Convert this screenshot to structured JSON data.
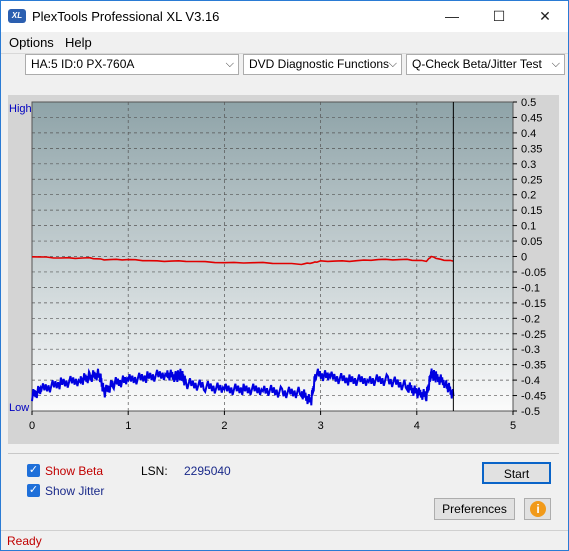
{
  "window": {
    "title": "PlexTools Professional XL V3.16",
    "app_icon": "XL"
  },
  "window_controls": {
    "minimize": "—",
    "maximize": "☐",
    "close": "✕"
  },
  "menu": {
    "options": "Options",
    "help": "Help"
  },
  "toolbar": {
    "drive": "HA:5 ID:0  PX-760A",
    "function": "DVD Diagnostic Functions",
    "test": "Q-Check Beta/Jitter Test"
  },
  "chart_data": {
    "type": "line",
    "x_ticks": [
      "0",
      "1",
      "2",
      "3",
      "4",
      "5"
    ],
    "y_right_ticks": [
      "0.5",
      "0.45",
      "0.4",
      "0.35",
      "0.3",
      "0.25",
      "0.2",
      "0.15",
      "0.1",
      "0.05",
      "0",
      "-0.05",
      "-0.1",
      "-0.15",
      "-0.2",
      "-0.25",
      "-0.3",
      "-0.35",
      "-0.4",
      "-0.45",
      "-0.5"
    ],
    "y_left_top": "High",
    "y_left_bottom": "Low",
    "xlim": [
      0,
      5
    ],
    "ylim": [
      -0.5,
      0.5
    ],
    "grid": true,
    "cursor_x": 4.38,
    "series": [
      {
        "color": "#e00000",
        "x": [
          0,
          0.3,
          0.6,
          0.75,
          1.0,
          1.3,
          1.6,
          2.0,
          2.4,
          2.8,
          2.92,
          3.0,
          3.3,
          3.6,
          3.9,
          4.1,
          4.15,
          4.25,
          4.38
        ],
        "values": [
          0.0,
          -0.005,
          -0.005,
          -0.01,
          -0.01,
          -0.015,
          -0.015,
          -0.02,
          -0.02,
          -0.025,
          -0.02,
          -0.015,
          -0.015,
          -0.01,
          -0.01,
          -0.015,
          0.0,
          -0.01,
          -0.015
        ]
      },
      {
        "color": "#0000e0",
        "x": [
          0,
          0.1,
          0.3,
          0.5,
          0.6,
          0.7,
          0.75,
          0.85,
          1.0,
          1.2,
          1.4,
          1.5,
          1.55,
          1.6,
          1.8,
          2.0,
          2.2,
          2.4,
          2.6,
          2.8,
          2.9,
          2.95,
          3.1,
          3.3,
          3.5,
          3.7,
          3.9,
          4.0,
          4.1,
          4.15,
          4.2,
          4.3,
          4.38
        ],
        "values": [
          -0.45,
          -0.43,
          -0.41,
          -0.4,
          -0.39,
          -0.38,
          -0.44,
          -0.41,
          -0.4,
          -0.39,
          -0.38,
          -0.39,
          -0.38,
          -0.41,
          -0.42,
          -0.43,
          -0.43,
          -0.43,
          -0.44,
          -0.44,
          -0.47,
          -0.38,
          -0.39,
          -0.4,
          -0.4,
          -0.4,
          -0.42,
          -0.44,
          -0.45,
          -0.38,
          -0.39,
          -0.41,
          -0.45
        ]
      }
    ]
  },
  "options_panel": {
    "show_beta": "Show Beta",
    "show_jitter": "Show Jitter",
    "beta_color": "#c00000",
    "jitter_color": "#1a2a8a",
    "lsn_label": "LSN:",
    "lsn_value": "2295040",
    "start_label": "Start",
    "preferences_label": "Preferences"
  },
  "status": {
    "text": "Ready"
  }
}
